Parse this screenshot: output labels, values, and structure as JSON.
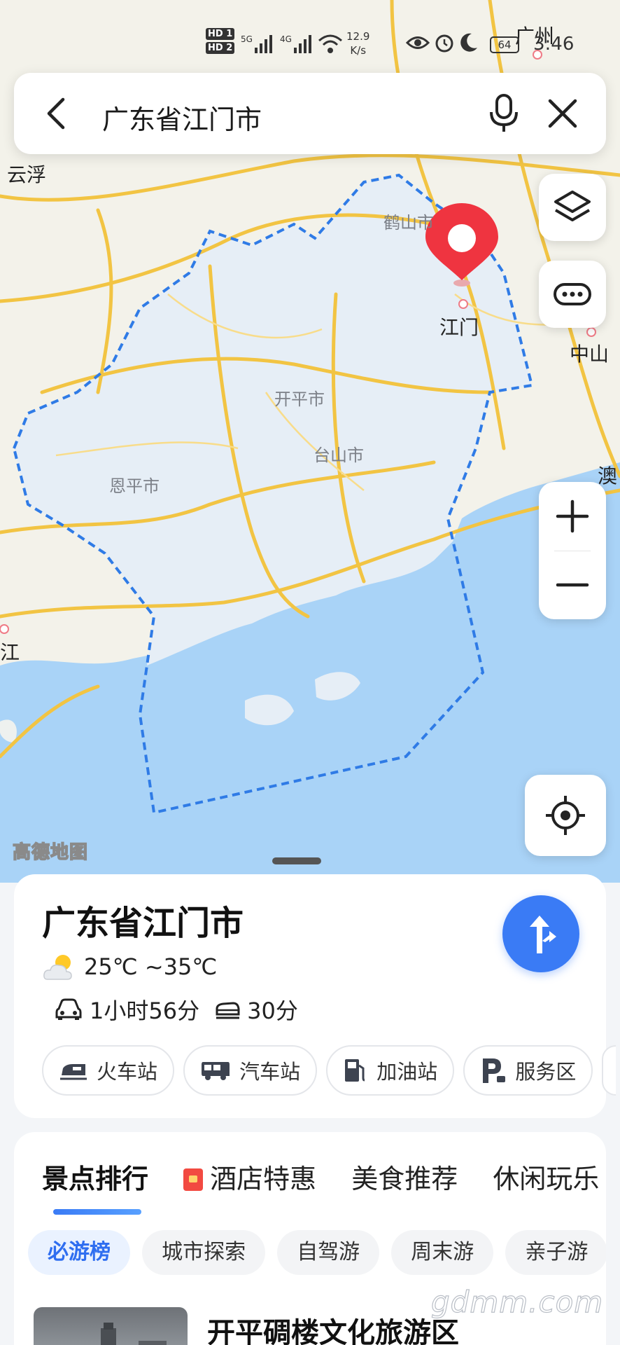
{
  "status_bar": {
    "hd1": "HD 1",
    "hd2": "HD 2",
    "net1": "5G",
    "net2": "4G",
    "speed_value": "12.9",
    "speed_unit": "K/s",
    "battery": "64",
    "time": "3:46"
  },
  "search": {
    "query": "广东省江门市"
  },
  "map": {
    "labels": {
      "guangzhou": "广州",
      "yunfu": "云浮",
      "heshan": "鹤山市",
      "jiangmen": "江门",
      "zhongshan": "中山",
      "kaiping": "开平市",
      "taishan": "台山市",
      "enping": "恩平市",
      "macau": "澳",
      "yangjiang": "阳江"
    },
    "brand": "高德地图",
    "colors": {
      "sea": "#a9d3f7",
      "region_fill": "#e6eef6",
      "boundary": "#2f7be6",
      "road": "#f2c443",
      "marker": "#ef3440"
    }
  },
  "place_card": {
    "title": "广东省江门市",
    "weather": "25℃ ~35℃",
    "drive_time": "1小时56分",
    "rail_time": "30分",
    "chips": [
      {
        "label": "火车站",
        "icon": "train-icon"
      },
      {
        "label": "汽车站",
        "icon": "bus-icon"
      },
      {
        "label": "加油站",
        "icon": "gas-station-icon"
      },
      {
        "label": "服务区",
        "icon": "parking-icon"
      }
    ]
  },
  "recommend": {
    "tabs": [
      "景点排行",
      "酒店特惠",
      "美食推荐",
      "休闲玩乐"
    ],
    "subtabs": [
      "必游榜",
      "城市探索",
      "自驾游",
      "周末游",
      "亲子游"
    ],
    "first_poi": "开平碉楼文化旅游区"
  },
  "watermark": "gdmm.com"
}
